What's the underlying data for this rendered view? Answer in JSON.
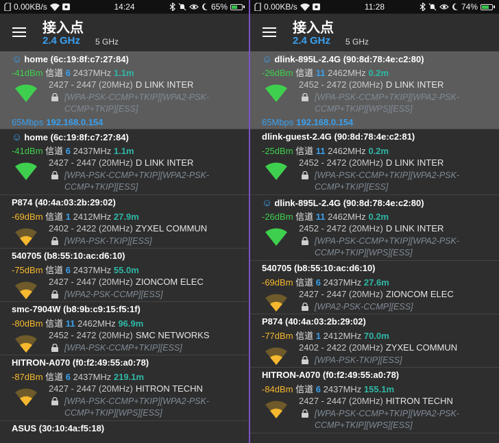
{
  "screens": [
    {
      "status": {
        "net_speed": "0.00KB/s",
        "time": "14:24",
        "battery": "65%",
        "battery_level": 0.65
      },
      "appbar": {
        "title": "接入点",
        "band_active": "2.4 GHz",
        "band_inactive": "5 GHz"
      },
      "connected": {
        "ssid": "home",
        "bssid": "(6c:19:8f:c7:27:84)",
        "dbm": "-41dBm",
        "ch_label": "信道",
        "channel": "6",
        "freq": "2437MHz",
        "dist": "1.1m",
        "range": "2427 - 2447",
        "width": "(20MHz)",
        "vendor": "D LINK INTER",
        "security": "[WPA-PSK-CCMP+TKIP][WPA2-PSK-CCMP+TKIP][ESS]",
        "rate": "65Mbps",
        "ip": "192.168.0.154"
      },
      "aps": [
        {
          "ssid": "home",
          "bssid": "(6c:19:8f:c7:27:84)",
          "dbm": "-41dBm",
          "ch_label": "信道",
          "channel": "6",
          "freq": "2437MHz",
          "dist": "1.1m",
          "range": "2427 - 2447",
          "width": "(20MHz)",
          "vendor": "D LINK INTER",
          "security": "[WPA-PSK-CCMP+TKIP][WPA2-PSK-CCMP+TKIP][ESS]",
          "signal": "strong",
          "smiley": true
        },
        {
          "ssid": "P874",
          "bssid": "(40:4a:03:2b:29:02)",
          "dbm": "-69dBm",
          "ch_label": "信道",
          "channel": "1",
          "freq": "2412MHz",
          "dist": "27.9m",
          "range": "2402 - 2422",
          "width": "(20MHz)",
          "vendor": "ZYXEL COMMUN",
          "security": "[WPA-PSK-TKIP][ESS]",
          "signal": "weak"
        },
        {
          "ssid": "540705",
          "bssid": "(b8:55:10:ac:d6:10)",
          "dbm": "-75dBm",
          "ch_label": "信道",
          "channel": "6",
          "freq": "2437MHz",
          "dist": "55.0m",
          "range": "2427 - 2447",
          "width": "(20MHz)",
          "vendor": "ZIONCOM ELEC",
          "security": "[WPA2-PSK-CCMP][ESS]",
          "signal": "weak"
        },
        {
          "ssid": "smc-7904W",
          "bssid": "(b8:9b:c9:15:f5:1f)",
          "dbm": "-80dBm",
          "ch_label": "信道",
          "channel": "11",
          "freq": "2462MHz",
          "dist": "96.9m",
          "range": "2452 - 2472",
          "width": "(20MHz)",
          "vendor": "SMC NETWORKS",
          "security": "[WPA-PSK-CCMP+TKIP][ESS]",
          "signal": "weak"
        },
        {
          "ssid": "HITRON-A070",
          "bssid": "(f0:f2:49:55:a0:78)",
          "dbm": "-87dBm",
          "ch_label": "信道",
          "channel": "6",
          "freq": "2437MHz",
          "dist": "219.1m",
          "range": "2427 - 2447",
          "width": "(20MHz)",
          "vendor": "HITRON TECHN",
          "security": "[WPA-PSK-CCMP+TKIP][WPA2-PSK-CCMP+TKIP][WPS][ESS]",
          "signal": "weak"
        },
        {
          "ssid": "ASUS",
          "bssid": "(30:10:4a:f5:18)",
          "dbm": "",
          "ch_label": "",
          "channel": "",
          "freq": "",
          "dist": "",
          "range": "",
          "width": "",
          "vendor": "",
          "security": "",
          "signal": "weak",
          "partial": true
        }
      ]
    },
    {
      "status": {
        "net_speed": "0.00KB/s",
        "time": "11:28",
        "battery": "74%",
        "battery_level": 0.74
      },
      "appbar": {
        "title": "接入点",
        "band_active": "2.4 GHz",
        "band_inactive": "5 GHz"
      },
      "connected": {
        "ssid": "dlink-895L-2.4G",
        "bssid": "(90:8d:78:4e:c2:80)",
        "dbm": "-26dBm",
        "ch_label": "信道",
        "channel": "11",
        "freq": "2462MHz",
        "dist": "0.2m",
        "range": "2452 - 2472",
        "width": "(20MHz)",
        "vendor": "D LINK INTER",
        "security": "[WPA-PSK-CCMP+TKIP][WPA2-PSK-CCMP+TKIP][WPS][ESS]",
        "rate": "65Mbps",
        "ip": "192.168.0.154"
      },
      "aps": [
        {
          "ssid": "dlink-guest-2.4G",
          "bssid": "(90:8d:78:4e:c2:81)",
          "dbm": "-25dBm",
          "ch_label": "信道",
          "channel": "11",
          "freq": "2462MHz",
          "dist": "0.2m",
          "range": "2452 - 2472",
          "width": "(20MHz)",
          "vendor": "D LINK INTER",
          "security": "[WPA-PSK-CCMP+TKIP][WPA2-PSK-CCMP+TKIP][ESS]",
          "signal": "strong"
        },
        {
          "ssid": "dlink-895L-2.4G",
          "bssid": "(90:8d:78:4e:c2:80)",
          "dbm": "-26dBm",
          "ch_label": "信道",
          "channel": "11",
          "freq": "2462MHz",
          "dist": "0.2m",
          "range": "2452 - 2472",
          "width": "(20MHz)",
          "vendor": "D LINK INTER",
          "security": "[WPA-PSK-CCMP+TKIP][WPA2-PSK-CCMP+TKIP][WPS][ESS]",
          "signal": "strong",
          "smiley": true
        },
        {
          "ssid": "540705",
          "bssid": "(b8:55:10:ac:d6:10)",
          "dbm": "-69dBm",
          "ch_label": "信道",
          "channel": "6",
          "freq": "2437MHz",
          "dist": "27.6m",
          "range": "2427 - 2447",
          "width": "(20MHz)",
          "vendor": "ZIONCOM ELEC",
          "security": "[WPA2-PSK-CCMP][ESS]",
          "signal": "weak"
        },
        {
          "ssid": "P874",
          "bssid": "(40:4a:03:2b:29:02)",
          "dbm": "-77dBm",
          "ch_label": "信道",
          "channel": "1",
          "freq": "2412MHz",
          "dist": "70.0m",
          "range": "2402 - 2422",
          "width": "(20MHz)",
          "vendor": "ZYXEL COMMUN",
          "security": "[WPA-PSK-TKIP][ESS]",
          "signal": "weak"
        },
        {
          "ssid": "HITRON-A070",
          "bssid": "(f0:f2:49:55:a0:78)",
          "dbm": "-84dBm",
          "ch_label": "信道",
          "channel": "6",
          "freq": "2437MHz",
          "dist": "155.1m",
          "range": "2427 - 2447",
          "width": "(20MHz)",
          "vendor": "HITRON TECHN",
          "security": "[WPA-PSK-CCMP+TKIP][WPA2-PSK-CCMP+TKIP][WPS][ESS]",
          "signal": "weak"
        }
      ]
    }
  ],
  "colors": {
    "accent": "#3aa0ee",
    "strong_signal": "#3fcf4e",
    "weak_signal": "#f5b82e",
    "distance": "#2fb7a6",
    "security": "#808b96",
    "divider": "#7c52c8"
  }
}
